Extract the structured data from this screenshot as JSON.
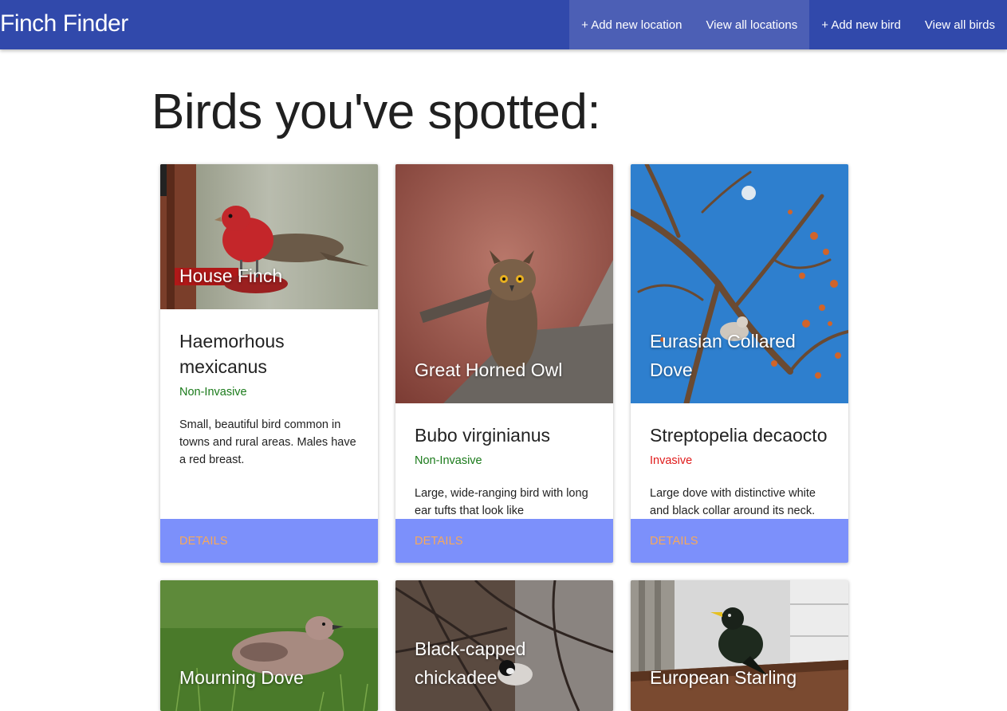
{
  "brand": "Finch Finder",
  "nav": {
    "add_location": "+ Add new location",
    "view_locations": "View all locations",
    "add_bird": "+ Add new bird",
    "view_birds": "View all birds"
  },
  "page_title": "Birds you've spotted:",
  "cards": [
    {
      "common_name": "House Finch",
      "scientific_name": "Haemorhous mexicanus",
      "status": "Non-Invasive",
      "description": "Small, beautiful bird common in towns and rural areas. Males have a red breast.",
      "action": "Details"
    },
    {
      "common_name": "Great Horned Owl",
      "scientific_name": "Bubo virginianus",
      "status": "Non-Invasive",
      "description": "Large, wide-ranging bird with long ear tufts that look like",
      "action": "Details"
    },
    {
      "common_name": "Eurasian Collared Dove",
      "scientific_name": "Streptopelia decaocto",
      "status": "Invasive",
      "description": "Large dove with distinctive white and black collar around its neck.",
      "action": "Details"
    },
    {
      "common_name": "Mourning Dove"
    },
    {
      "common_name": "Black-capped chickadee"
    },
    {
      "common_name": "European Starling"
    }
  ],
  "colors": {
    "navbar": "#3149ab",
    "nav_active": "#4c5fb5",
    "card_action_bg": "#7c90fb",
    "details_text": "#f7a85a",
    "non_invasive": "#1a7a1a",
    "invasive": "#e01a1a"
  }
}
